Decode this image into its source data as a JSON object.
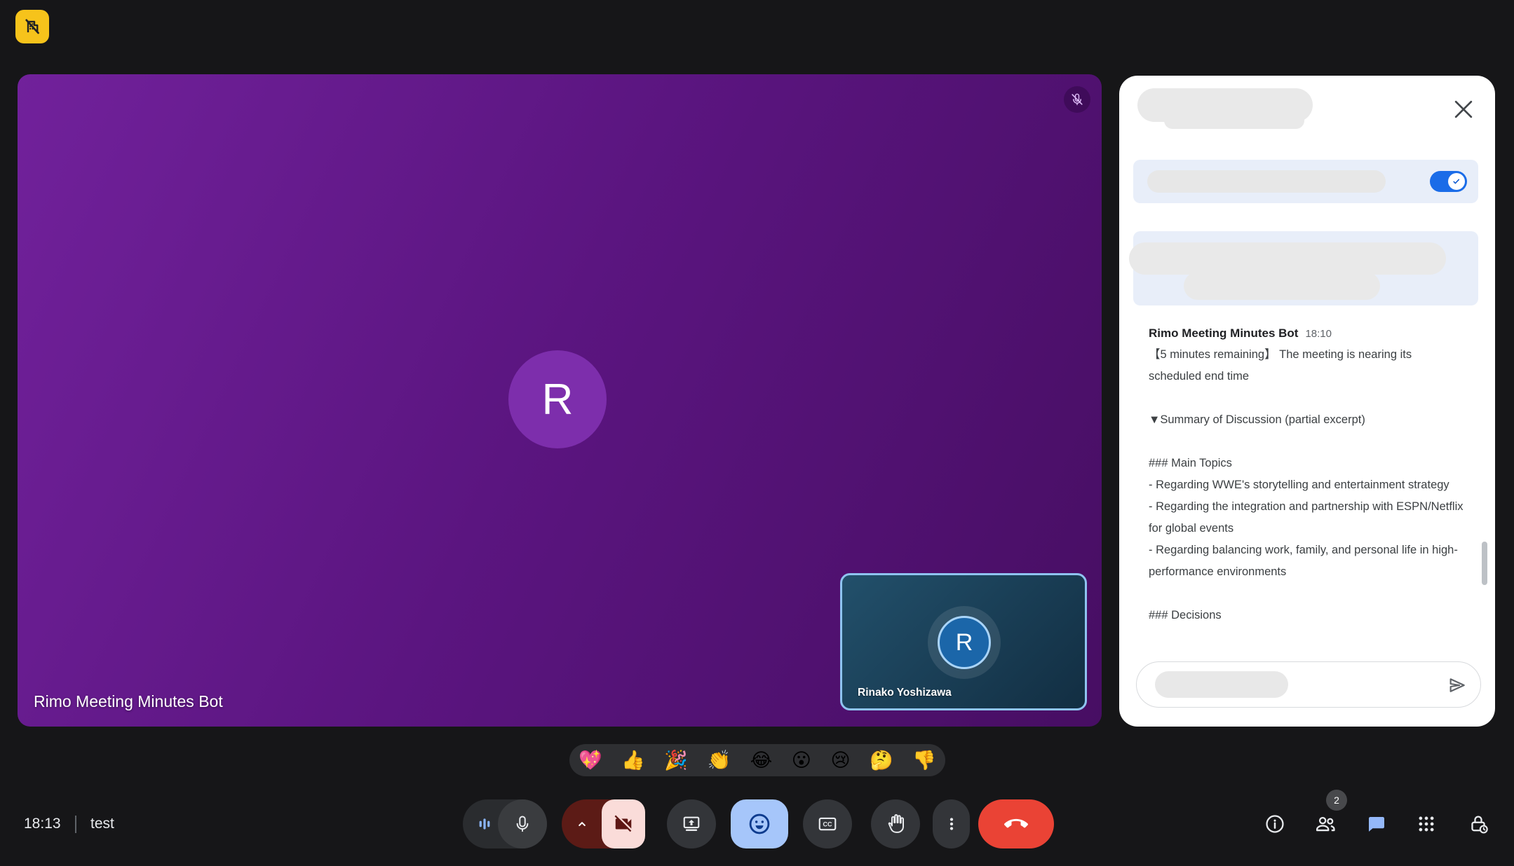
{
  "statusBar": {
    "clock": "18:13",
    "meetingName": "test"
  },
  "tiles": {
    "main": {
      "name": "Rimo Meeting Minutes Bot",
      "initial": "R",
      "muted": true
    },
    "self": {
      "name": "Rinako Yoshizawa",
      "initial": "R"
    }
  },
  "chat": {
    "toggle_on": true,
    "message": {
      "sender": "Rimo Meeting Minutes Bot",
      "time": "18:10",
      "intro": "【5 minutes remaining】 The meeting is nearing its scheduled end time",
      "summaryHeading": "▼Summary of Discussion (partial excerpt)",
      "mainTopics": "### Main Topics\n- Regarding WWE's storytelling and entertainment strategy\n- Regarding the integration and partnership with ESPN/Netflix for global events\n- Regarding balancing work, family, and personal life in high-performance environments",
      "decisionsHeading": "### Decisions"
    }
  },
  "reactions": {
    "emojis": [
      "💖",
      "👍",
      "🎉",
      "👏",
      "😂",
      "😮",
      "😢",
      "🤔",
      "👎"
    ]
  },
  "toolbar": {
    "cc": "CC"
  },
  "participants": {
    "count": "2"
  },
  "colors": {
    "accentBlue": "#1a6ce8",
    "activeChipBlue": "#a6c6fa",
    "endCallRed": "#ea4335",
    "alertYellow": "#f6c31b",
    "mainTilePurple": "#5b1580",
    "selfTileBlue": "#1b66a9",
    "cameraOffPink": "#fadcd9",
    "cameraOffMaroon": "#5c1b16"
  }
}
